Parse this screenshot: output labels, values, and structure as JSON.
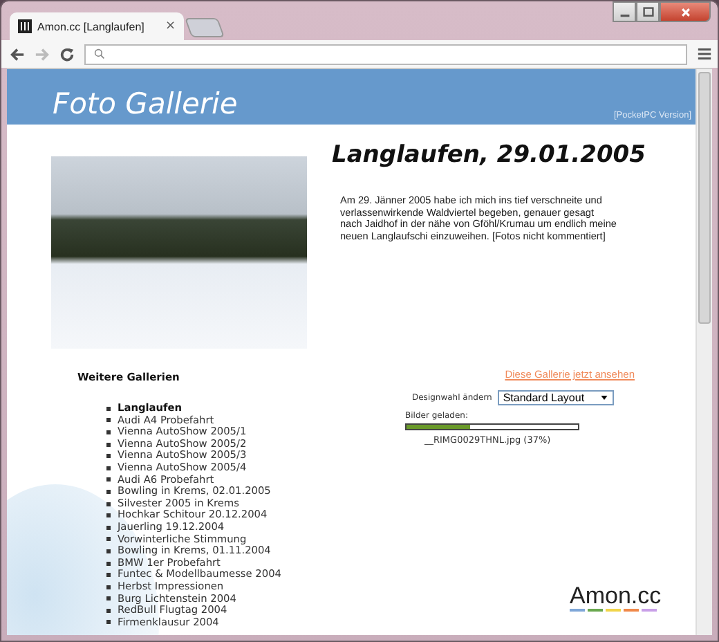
{
  "browser": {
    "tab_title": "Amon.cc [Langlaufen]",
    "tab_close": "×"
  },
  "header": {
    "title": "Foto Gallerie",
    "pocketpc_link": "[PocketPC Version]"
  },
  "gallery": {
    "title": "Langlaufen, 29.01.2005",
    "description": "Am 29. Jänner 2005 habe ich mich ins tief verschneite und verlassenwirkende Waldviertel begeben, genauer gesagt nach Jaidhof in der nähe von Gföhl/Krumau um endlich meine neuen Langlaufschi einzuweihen. [Fotos nicht kommentiert]"
  },
  "more_galleries": {
    "heading": "Weitere Gallerien",
    "items": [
      {
        "label": "Langlaufen",
        "selected": true
      },
      {
        "label": "Audi A4 Probefahrt",
        "selected": false
      },
      {
        "label": "Vienna AutoShow 2005/1",
        "selected": false
      },
      {
        "label": "Vienna AutoShow 2005/2",
        "selected": false
      },
      {
        "label": "Vienna AutoShow 2005/3",
        "selected": false
      },
      {
        "label": "Vienna AutoShow 2005/4",
        "selected": false
      },
      {
        "label": "Audi A6 Probefahrt",
        "selected": false
      },
      {
        "label": "Bowling in Krems, 02.01.2005",
        "selected": false
      },
      {
        "label": "Silvester 2005 in Krems",
        "selected": false
      },
      {
        "label": "Hochkar Schitour 20.12.2004",
        "selected": false
      },
      {
        "label": "Jauerling 19.12.2004",
        "selected": false
      },
      {
        "label": "Vorwinterliche Stimmung",
        "selected": false
      },
      {
        "label": "Bowling in Krems, 01.11.2004",
        "selected": false
      },
      {
        "label": "BMW 1er Probefahrt",
        "selected": false
      },
      {
        "label": "Funtec & Modellbaumesse 2004",
        "selected": false
      },
      {
        "label": "Herbst Impressionen",
        "selected": false
      },
      {
        "label": "Burg Lichtenstein 2004",
        "selected": false
      },
      {
        "label": "RedBull Flugtag 2004",
        "selected": false
      },
      {
        "label": "Firmenklausur 2004",
        "selected": false
      }
    ]
  },
  "view_link": "Diese Gallerie jetzt ansehen",
  "design": {
    "label": "Designwahl ändern",
    "value": "Standard Layout"
  },
  "loading": {
    "label": "Bilder geladen:",
    "level": 0.37,
    "file": "__RIMG0029THNL.jpg (37%)"
  },
  "logo": {
    "text": "Amon.cc",
    "stripes": [
      {
        "color": "#7fa7d8"
      },
      {
        "color": "#6aa84f"
      },
      {
        "color": "#f1d54a"
      },
      {
        "color": "#f0894a"
      },
      {
        "color": "#c9a0e8"
      }
    ]
  }
}
